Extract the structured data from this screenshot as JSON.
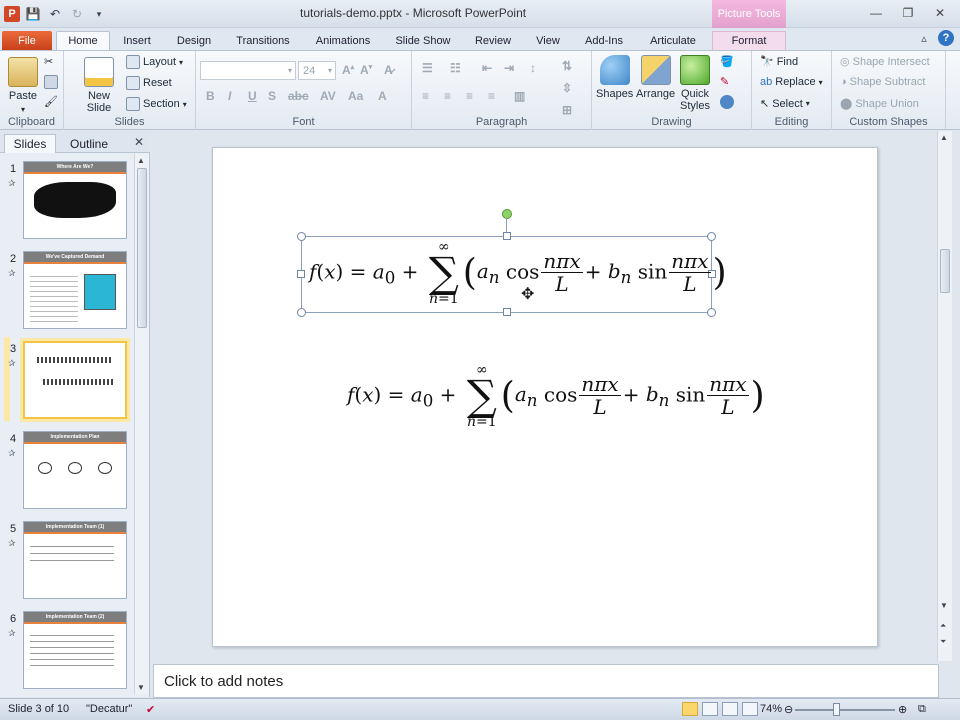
{
  "window": {
    "title": "tutorials-demo.pptx - Microsoft PowerPoint",
    "context_tab_header": "Picture Tools"
  },
  "tabs": [
    "File",
    "Home",
    "Insert",
    "Design",
    "Transitions",
    "Animations",
    "Slide Show",
    "Review",
    "View",
    "Add-Ins",
    "Articulate",
    "Format"
  ],
  "ribbon": {
    "clipboard": {
      "label": "Clipboard",
      "paste": "Paste"
    },
    "slides": {
      "label": "Slides",
      "new_slide": "New\nSlide",
      "layout": "Layout",
      "reset": "Reset",
      "section": "Section"
    },
    "font": {
      "label": "Font",
      "size": "24"
    },
    "paragraph": {
      "label": "Paragraph"
    },
    "drawing": {
      "label": "Drawing",
      "shapes": "Shapes",
      "arrange": "Arrange",
      "quick_styles": "Quick\nStyles"
    },
    "editing": {
      "label": "Editing",
      "find": "Find",
      "replace": "Replace",
      "select": "Select"
    },
    "custom_shapes": {
      "label": "Custom Shapes",
      "intersect": "Shape Intersect",
      "subtract": "Shape Subtract",
      "union": "Shape Union"
    }
  },
  "left_pane": {
    "tabs": [
      "Slides",
      "Outline"
    ],
    "slides": [
      {
        "number": "1",
        "title": "Where Are We?"
      },
      {
        "number": "2",
        "title": "We've Captured Demand"
      },
      {
        "number": "3",
        "title": ""
      },
      {
        "number": "4",
        "title": "Implementation Plan"
      },
      {
        "number": "5",
        "title": "Implementation Team (1)"
      },
      {
        "number": "6",
        "title": "Implementation Team (2)"
      }
    ]
  },
  "slide": {
    "equation_text": "f(x) = a0 + Σ(n=1..∞) (an cos(nπx/L) + bn sin(nπx/L))"
  },
  "notes": {
    "placeholder": "Click to add notes"
  },
  "status": {
    "slide_info": "Slide 3 of 10",
    "theme": "\"Decatur\"",
    "zoom": "74%"
  },
  "colors": {
    "file_tab": "#d24726",
    "selection": "#f4c543",
    "accent": "#e8823a"
  }
}
